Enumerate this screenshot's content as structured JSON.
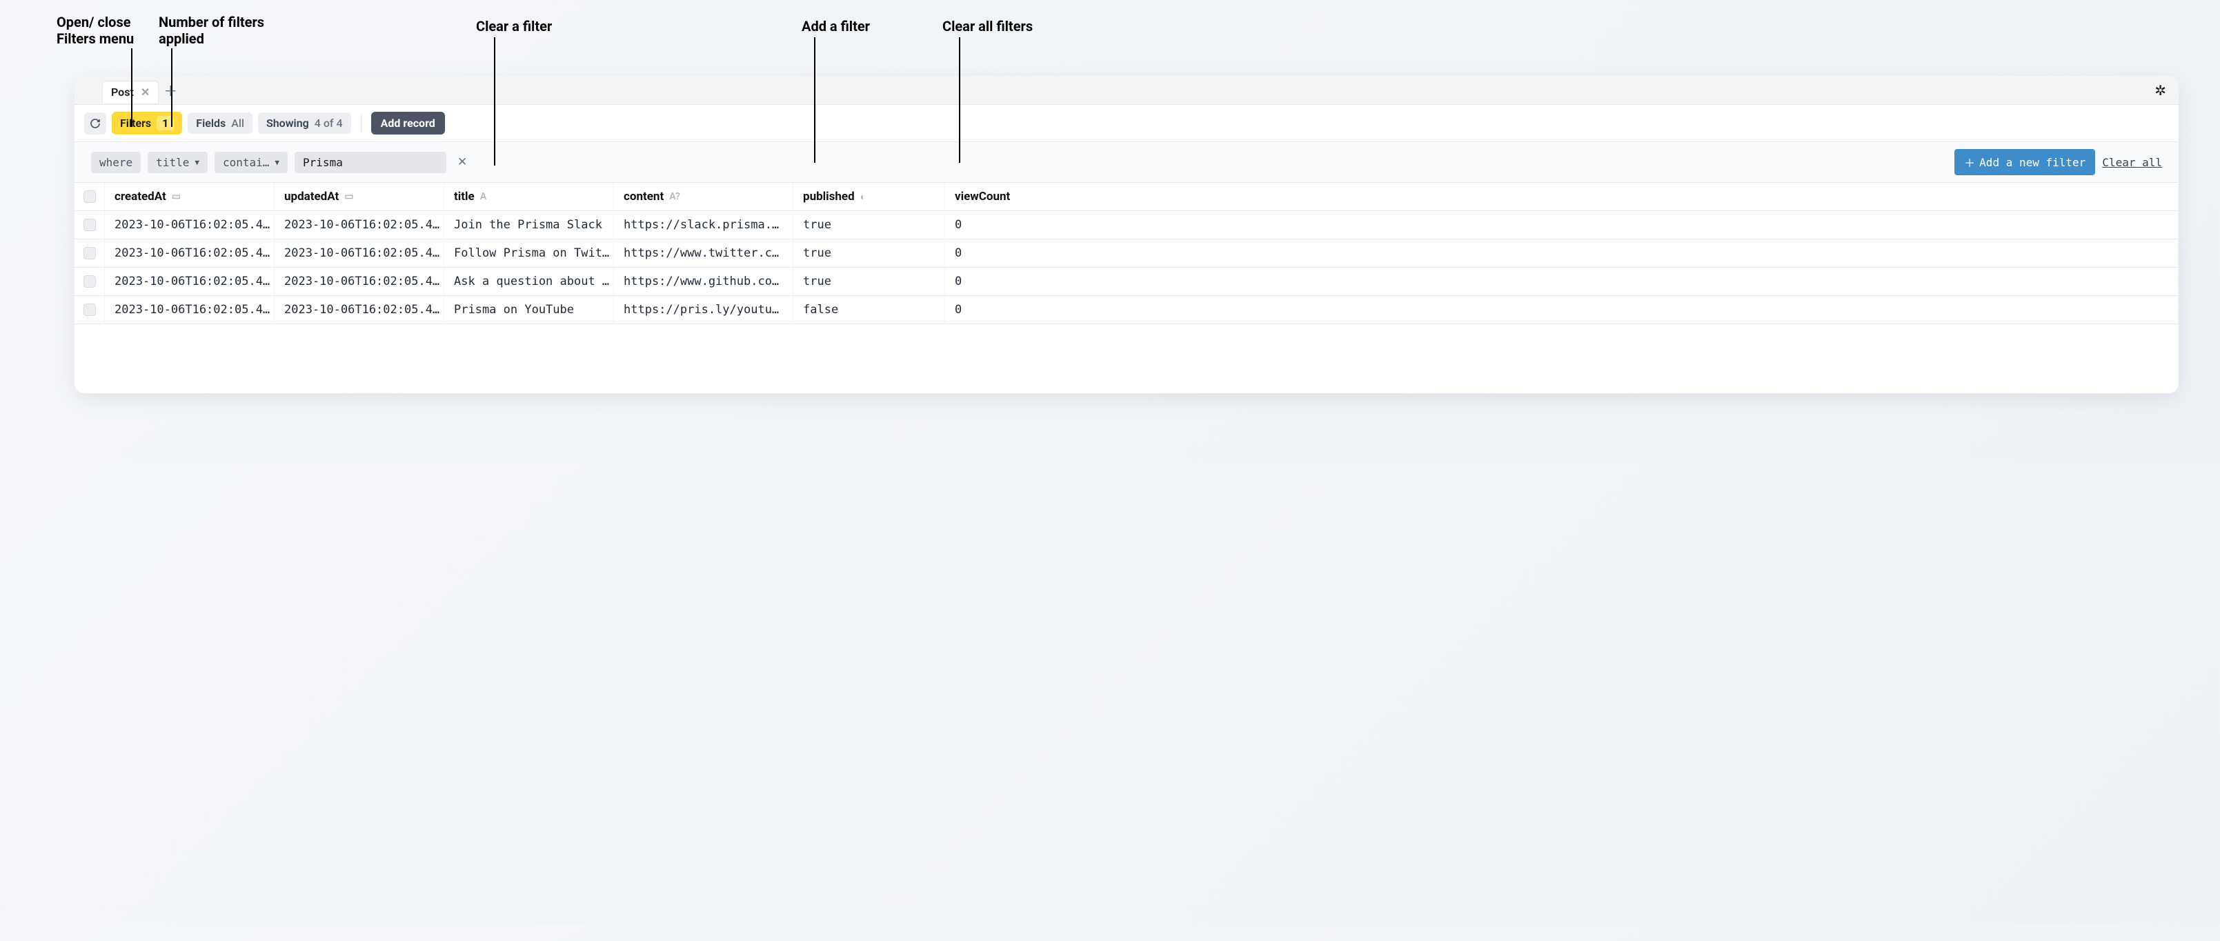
{
  "annotations": {
    "open_close": "Open/ close\nFilters menu",
    "num_applied": "Number of filters\napplied",
    "clear_filter": "Clear a filter",
    "add_filter": "Add a filter",
    "clear_all": "Clear all filters"
  },
  "tabs": {
    "active": "Post"
  },
  "toolbar": {
    "filters_label": "Filters",
    "filters_count": "1",
    "fields_label": "Fields",
    "fields_value": "All",
    "showing_label": "Showing",
    "showing_value": "4 of 4",
    "add_record": "Add record"
  },
  "filter": {
    "where": "where",
    "field": "title",
    "operator": "contai…",
    "value": "Prisma",
    "add_new": "Add a new filter",
    "clear_all": "Clear all"
  },
  "columns": [
    "createdAt",
    "updatedAt",
    "title",
    "content",
    "published",
    "viewCount"
  ],
  "column_types": [
    "date",
    "date",
    "string",
    "string_opt",
    "bool",
    "int"
  ],
  "rows": [
    {
      "createdAt": "2023-10-06T16:02:05.4…",
      "updatedAt": "2023-10-06T16:02:05.4…",
      "title": "Join the Prisma Slack",
      "content": "https://slack.prisma.…",
      "published": "true",
      "viewCount": "0"
    },
    {
      "createdAt": "2023-10-06T16:02:05.4…",
      "updatedAt": "2023-10-06T16:02:05.4…",
      "title": "Follow Prisma on Twit…",
      "content": "https://www.twitter.c…",
      "published": "true",
      "viewCount": "0"
    },
    {
      "createdAt": "2023-10-06T16:02:05.4…",
      "updatedAt": "2023-10-06T16:02:05.4…",
      "title": "Ask a question about …",
      "content": "https://www.github.co…",
      "published": "true",
      "viewCount": "0"
    },
    {
      "createdAt": "2023-10-06T16:02:05.4…",
      "updatedAt": "2023-10-06T16:02:05.4…",
      "title": "Prisma on YouTube",
      "content": "https://pris.ly/youtu…",
      "published": "false",
      "viewCount": "0"
    }
  ]
}
